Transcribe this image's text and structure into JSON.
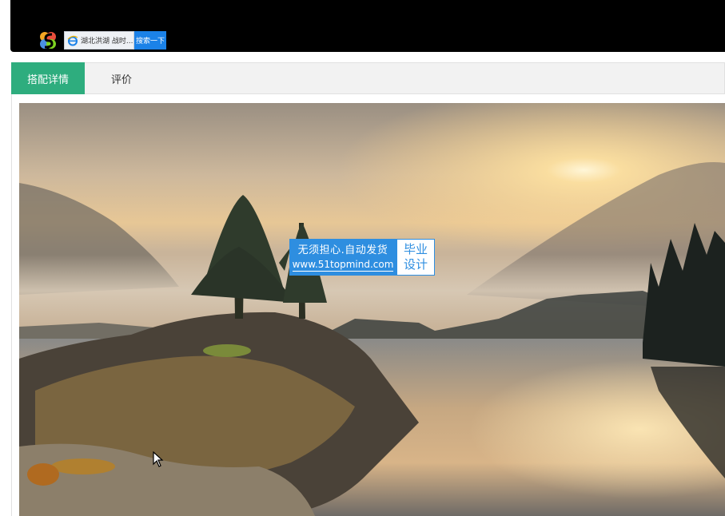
{
  "toolbar": {
    "search_value": "湖北洪湖 战时...",
    "search_button": "搜索一下"
  },
  "tabs": [
    {
      "label": "搭配详情",
      "active": true
    },
    {
      "label": "评价",
      "active": false
    }
  ],
  "watermark": {
    "line1": "无须担心.自动发货",
    "line2": "www.51topmind.com",
    "badge_line1": "毕业",
    "badge_line2": "设计"
  },
  "colors": {
    "tab_active": "#2ead7e",
    "search_button": "#1b82e8",
    "watermark_blue": "#2e8ee0"
  }
}
